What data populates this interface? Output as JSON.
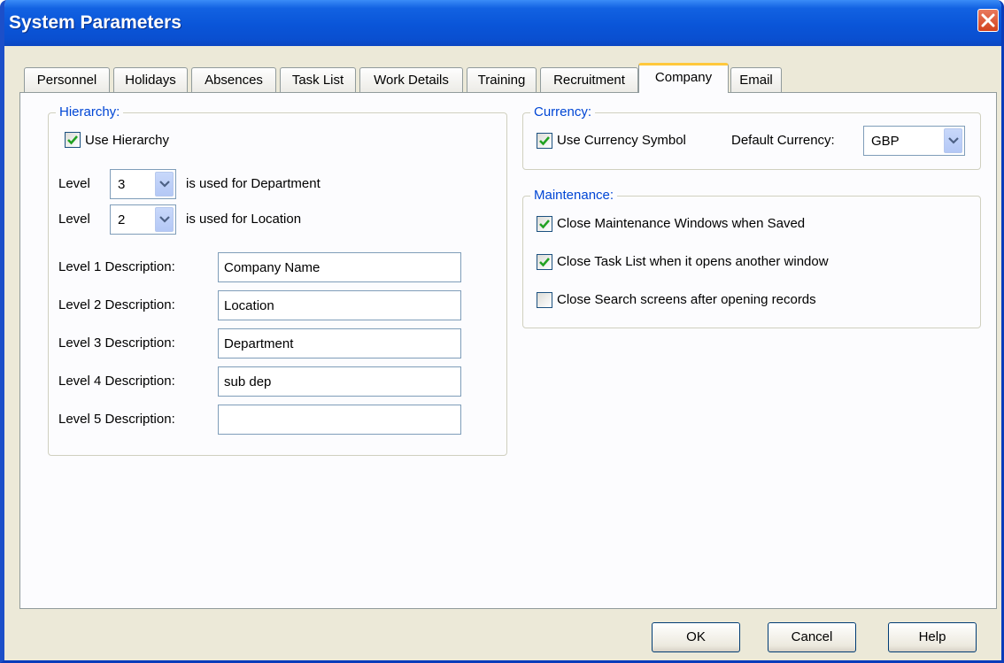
{
  "window": {
    "title": "System Parameters"
  },
  "tabs": [
    {
      "label": "Personnel"
    },
    {
      "label": "Holidays"
    },
    {
      "label": "Absences"
    },
    {
      "label": "Task List"
    },
    {
      "label": "Work Details"
    },
    {
      "label": "Training"
    },
    {
      "label": "Recruitment"
    },
    {
      "label": "Company",
      "active": true
    },
    {
      "label": "Email"
    }
  ],
  "hierarchy": {
    "label": "Hierarchy:",
    "use_hierarchy": {
      "label": "Use Hierarchy",
      "checked": true
    },
    "level_word": "Level",
    "department_level": {
      "value": "3",
      "suffix": "is used for Department"
    },
    "location_level": {
      "value": "2",
      "suffix": "is used for Location"
    },
    "descriptions": [
      {
        "label": "Level 1 Description:",
        "value": "Company Name"
      },
      {
        "label": "Level 2 Description:",
        "value": "Location"
      },
      {
        "label": "Level 3 Description:",
        "value": "Department"
      },
      {
        "label": "Level 4 Description:",
        "value": "sub dep"
      },
      {
        "label": "Level 5 Description:",
        "value": ""
      }
    ]
  },
  "currency": {
    "label": "Currency:",
    "use_symbol": {
      "label": "Use Currency Symbol",
      "checked": true
    },
    "default_label": "Default Currency:",
    "default_value": "GBP"
  },
  "maintenance": {
    "label": "Maintenance:",
    "options": [
      {
        "label": "Close Maintenance Windows when Saved",
        "checked": true
      },
      {
        "label": "Close Task List when it opens another window",
        "checked": true
      },
      {
        "label": "Close Search screens after opening records",
        "checked": false
      }
    ]
  },
  "buttons": {
    "ok": "OK",
    "cancel": "Cancel",
    "help": "Help"
  },
  "colors": {
    "titlebar": "#0a55d8",
    "group_label": "#0046d5",
    "active_tab_accent": "#ffc83c"
  },
  "icons": {
    "close": "close-x-icon",
    "dropdown": "chevron-down-icon",
    "check": "checkmark-icon"
  }
}
